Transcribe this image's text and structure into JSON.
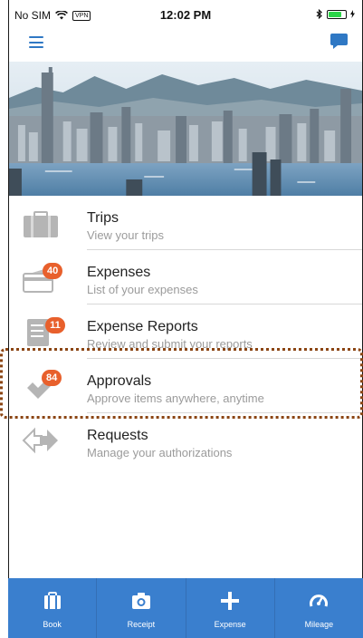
{
  "status_bar": {
    "carrier": "No SIM",
    "vpn": "VPN",
    "time": "12:02 PM"
  },
  "nav": {
    "menu_icon": "hamburger-menu-icon",
    "chat_icon": "chat-bubble-icon"
  },
  "menu": {
    "items": [
      {
        "title": "Trips",
        "subtitle": "View your trips",
        "badge": "",
        "icon": "briefcase-icon"
      },
      {
        "title": "Expenses",
        "subtitle": "List of your expenses",
        "badge": "40",
        "icon": "wallet-icon"
      },
      {
        "title": "Expense Reports",
        "subtitle": "Review and submit your reports",
        "badge": "11",
        "icon": "document-icon"
      },
      {
        "title": "Approvals",
        "subtitle": "Approve items anywhere, anytime",
        "badge": "84",
        "icon": "checkmark-icon"
      },
      {
        "title": "Requests",
        "subtitle": "Manage your authorizations",
        "badge": "",
        "icon": "arrows-icon"
      }
    ]
  },
  "tabs": [
    {
      "label": "Book",
      "icon": "briefcase-icon"
    },
    {
      "label": "Receipt",
      "icon": "camera-icon"
    },
    {
      "label": "Expense",
      "icon": "plus-icon"
    },
    {
      "label": "Mileage",
      "icon": "speedometer-icon"
    }
  ],
  "colors": {
    "accent": "#3a7fce",
    "badge": "#e8602c",
    "highlight_border": "#8b4513"
  }
}
